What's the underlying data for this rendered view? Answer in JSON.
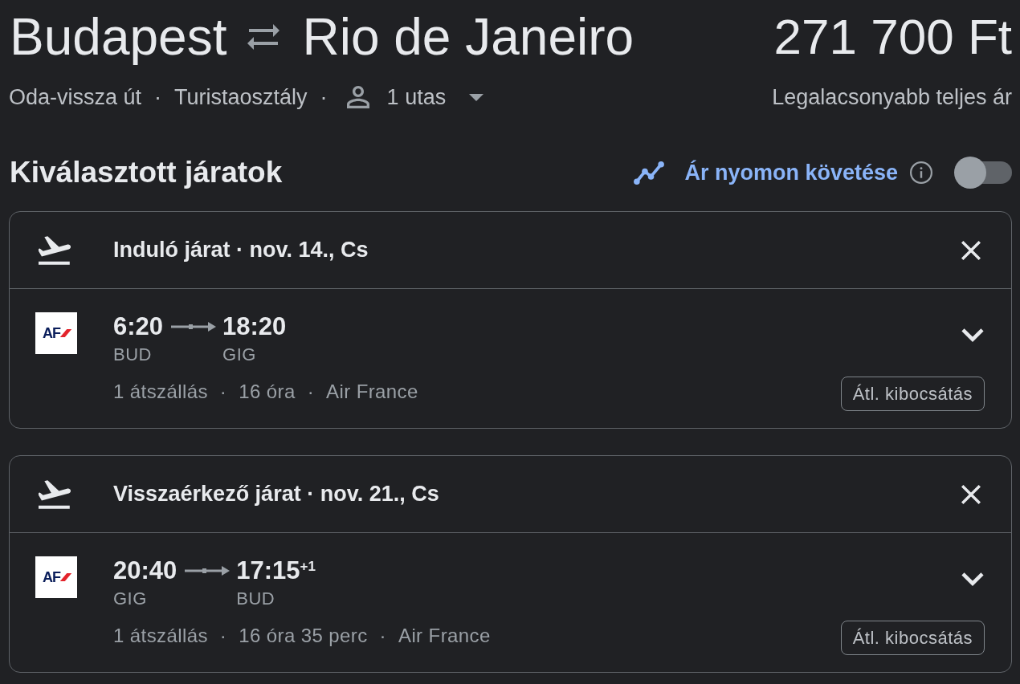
{
  "route": {
    "origin": "Budapest",
    "destination": "Rio de Janeiro"
  },
  "price": {
    "amount": "271 700 Ft",
    "caption": "Legalacsonyabb teljes ár"
  },
  "trip_summary": [
    {
      "kind": "text",
      "label": "Oda-vissza út"
    },
    {
      "kind": "separator",
      "label": "·"
    },
    {
      "kind": "text",
      "label": "Turistaosztály"
    },
    {
      "kind": "separator",
      "label": "·"
    },
    {
      "kind": "passengers",
      "label": "1 utas"
    }
  ],
  "section_title": "Kiválasztott járatok",
  "price_tracking": {
    "label": "Ár nyomon követése",
    "on": false
  },
  "flights": [
    {
      "header": "Induló járat · nov. 14., Cs",
      "logo_text": "AF",
      "departure": {
        "time": "6:20",
        "airport": "BUD"
      },
      "arrival": {
        "time": "18:20",
        "airport": "GIG"
      },
      "details": [
        {
          "kind": "text",
          "text": "1 átszállás"
        },
        {
          "kind": "separator",
          "text": "·"
        },
        {
          "kind": "text",
          "text": "16 óra"
        },
        {
          "kind": "separator",
          "text": "·"
        },
        {
          "kind": "text",
          "text": "Air France"
        }
      ],
      "emissions_button": "Átl. kibocsátás",
      "expanded": false
    },
    {
      "header": "Visszaérkező járat · nov. 21., Cs",
      "logo_text": "AF",
      "departure": {
        "time": "20:40",
        "airport": "GIG"
      },
      "arrival": {
        "time": "17:15",
        "day_offset": "+1",
        "airport": "BUD"
      },
      "details": [
        {
          "kind": "text",
          "text": "1 átszállás"
        },
        {
          "kind": "separator",
          "text": "·"
        },
        {
          "kind": "text",
          "text": "16 óra 35 perc"
        },
        {
          "kind": "separator",
          "text": "·"
        },
        {
          "kind": "text",
          "text": "Air France"
        }
      ],
      "emissions_button": "Átl. kibocsátás",
      "expanded": false
    }
  ]
}
